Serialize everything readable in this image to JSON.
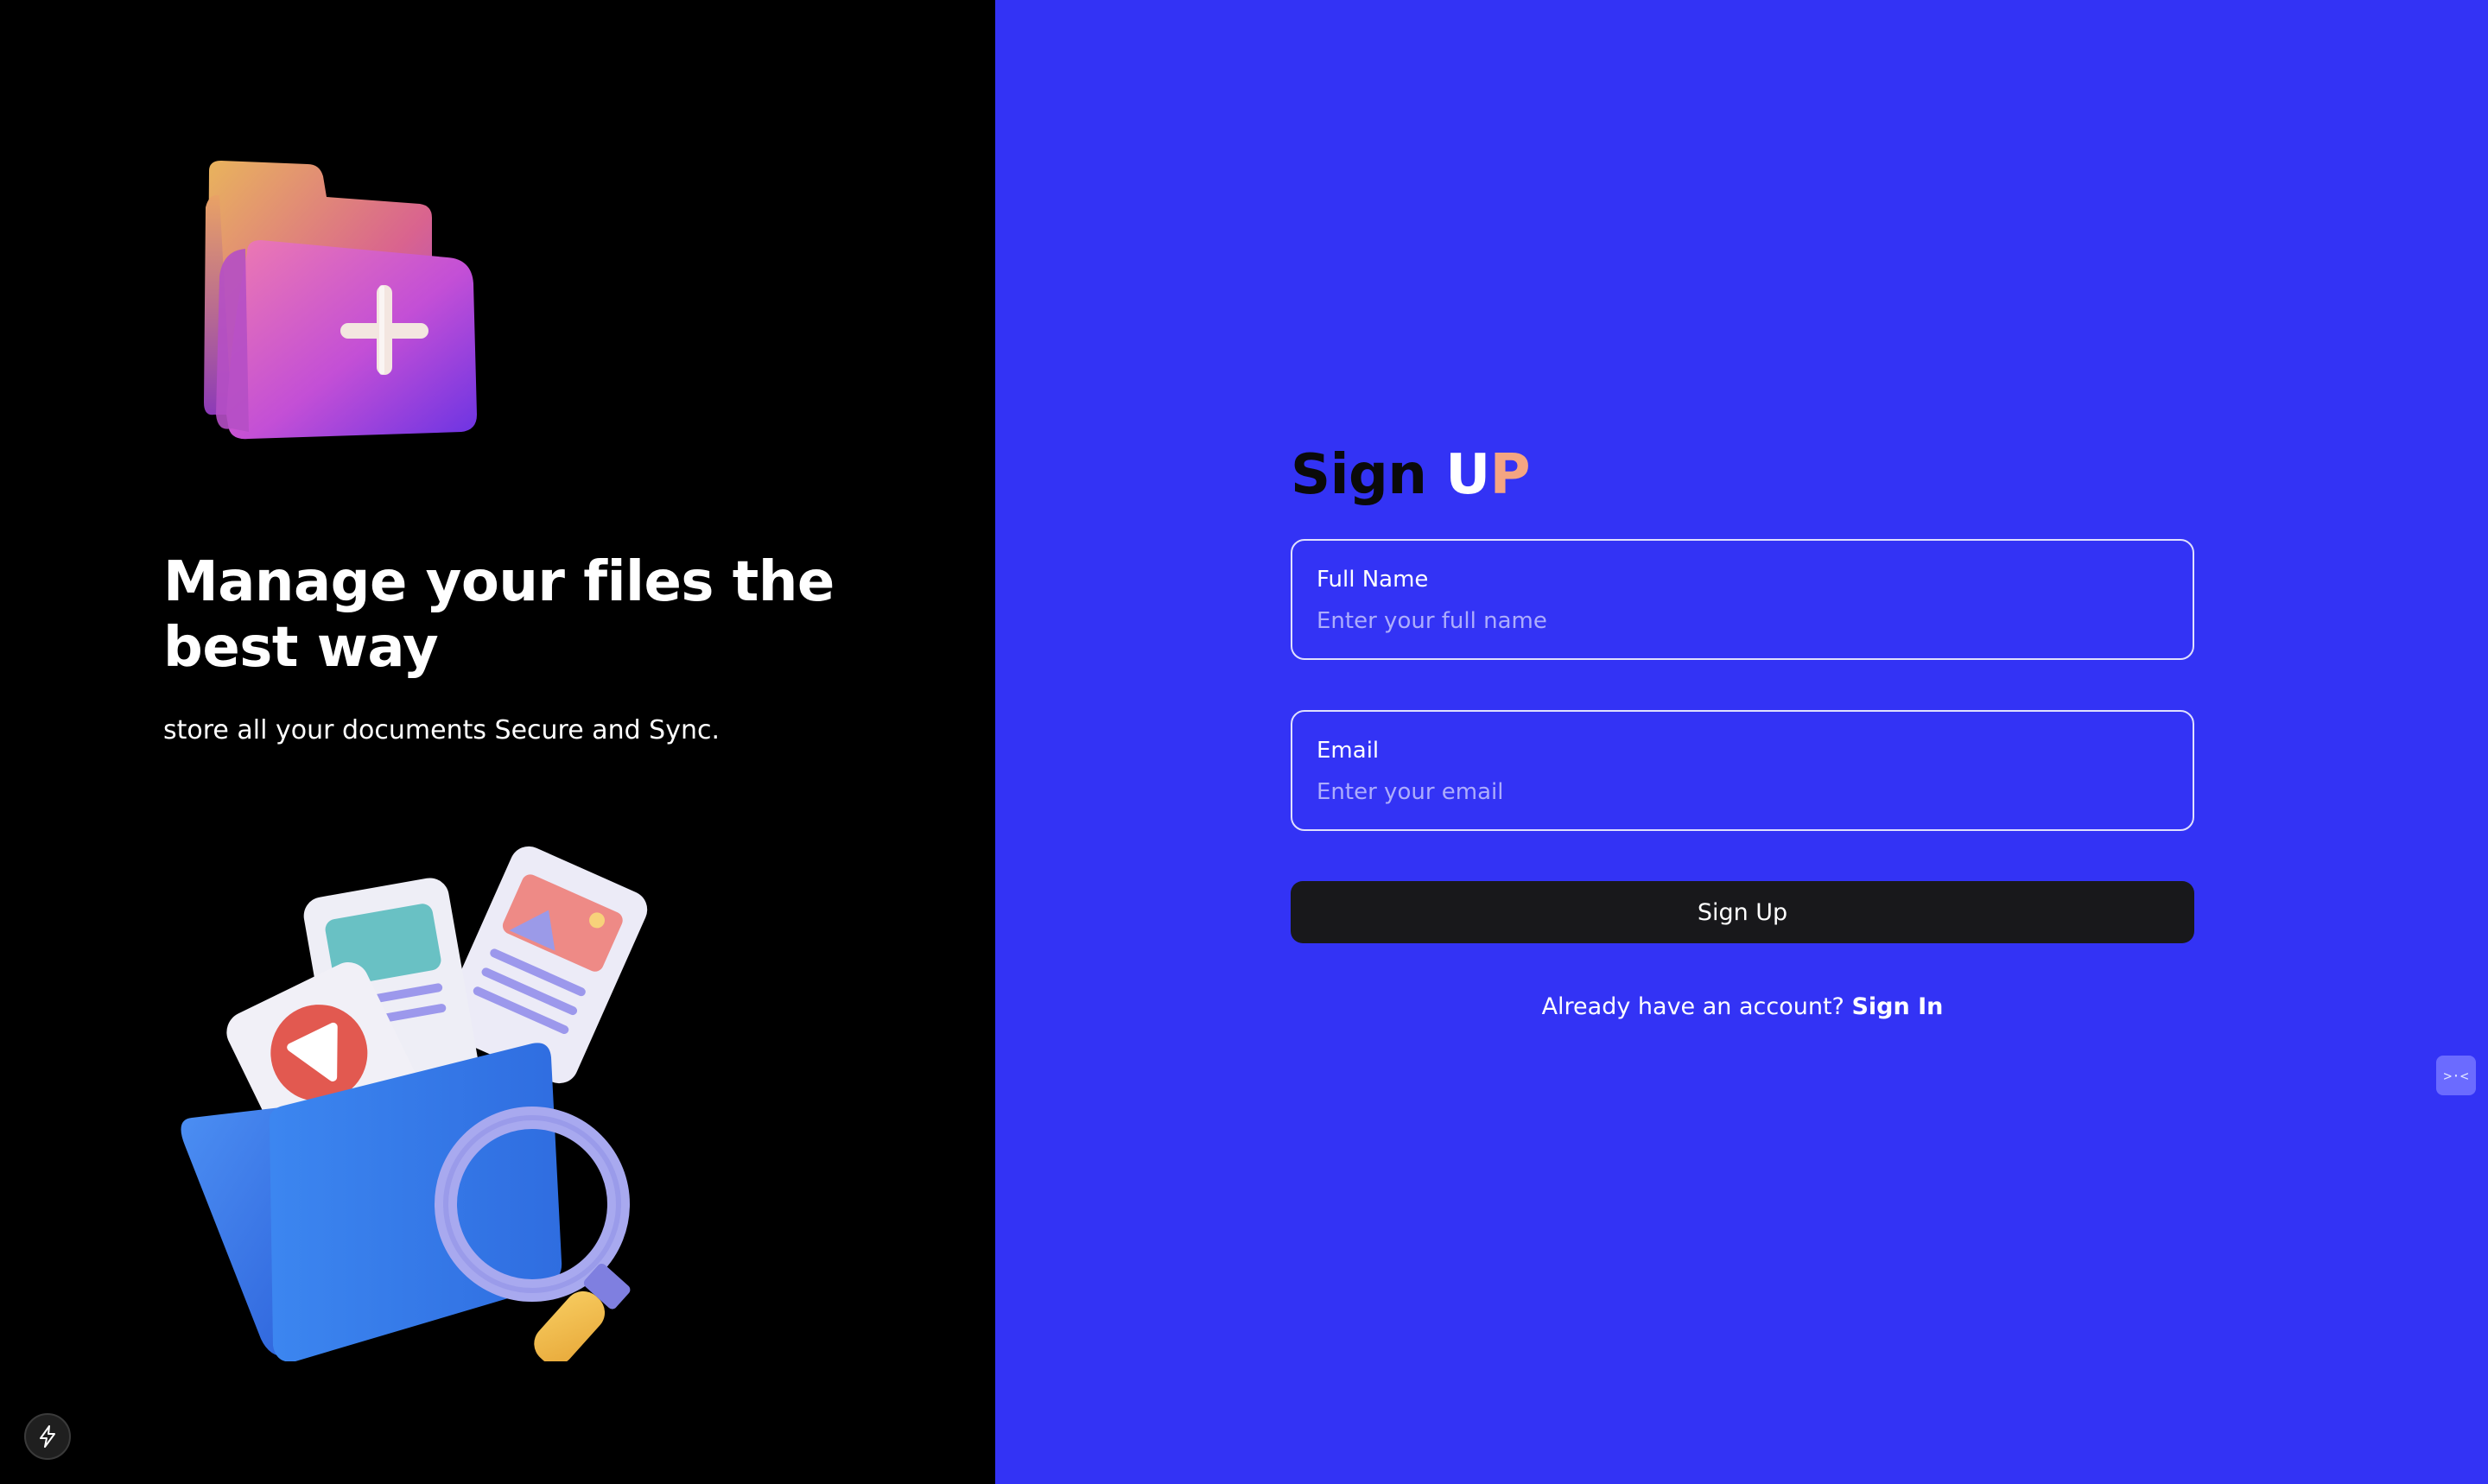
{
  "left_panel": {
    "headline": "Manage your files the best way",
    "tagline": "store all your documents Secure and Sync.",
    "top_illustration_icon": "folder-plus-icon",
    "bottom_illustration_icon": "documents-folder-search-icon",
    "badge_icon": "lightning-icon"
  },
  "form": {
    "title_part1": "Sign ",
    "title_part2": "U",
    "title_part3": "P",
    "fields": [
      {
        "label": "Full Name",
        "placeholder": "Enter your full name",
        "value": ""
      },
      {
        "label": "Email",
        "placeholder": "Enter your email",
        "value": ""
      }
    ],
    "submit_label": "Sign Up",
    "signin_prompt": "Already have an account?",
    "signin_link": "Sign In"
  },
  "side_widget": {
    "icon": "collapse-arrows-icon",
    "label": ">·<"
  },
  "colors": {
    "left_background": "#000000",
    "right_background": "#3333f5",
    "button_background": "#18181b",
    "title_accent": "#f4a582"
  }
}
